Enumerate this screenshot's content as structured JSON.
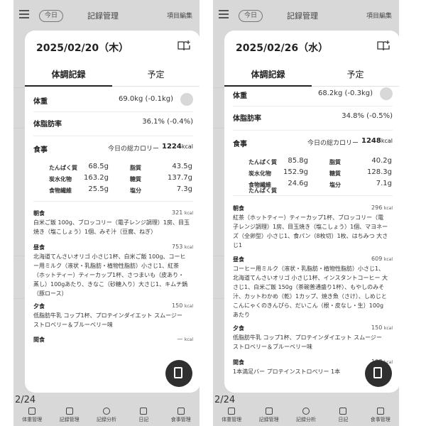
{
  "app": {
    "today_label": "今日",
    "title": "記録管理",
    "edit_label": "項目編集",
    "bg_date": "2/24",
    "nav": [
      "体重管理",
      "体重管理",
      "記録管理",
      "記録分析",
      "日記",
      "食事管理"
    ]
  },
  "left": {
    "date": "2025/02/20（木）",
    "tabs": [
      "体調記録",
      "予定"
    ],
    "weight_label": "体重",
    "weight_value": "69.0kg (-0.1kg)",
    "bodyfat_label": "体脂肪率",
    "bodyfat_value": "36.1% (-0.4%)",
    "meal_label": "食事",
    "total_label": "今日の総カロリー",
    "total_value": "1224",
    "kcal": "kcal",
    "nutrients": [
      {
        "name": "たんぱく質",
        "value": "68.5g"
      },
      {
        "name": "脂質",
        "value": "43.5g"
      },
      {
        "name": "炭水化物",
        "value": "163.2g"
      },
      {
        "name": "糖質",
        "value": "137.7g"
      },
      {
        "name": "食物繊維",
        "value": "25.5g"
      },
      {
        "name": "塩分",
        "value": "7.3g"
      }
    ],
    "meals": [
      {
        "name": "朝食",
        "kcal": "321",
        "text": "白米ご飯 100g、ブロッコリー（電子レンジ調理）1房、目玉焼き（塩こしょう）1個、みそ汁（豆腐、ねぎ）"
      },
      {
        "name": "昼食",
        "kcal": "753",
        "text": "北海道てんさいオリゴ 小さじ1杯、白米ご飯 100g、コーヒー用ミルク（液状・乳脂肪・植物性脂肪）小さじ1、紅茶（ホットティー）ティーカップ1杯、さつまいも（皮あり・蒸し）100gあたり、きなこ（砂糖入り）大さじ1、キムチ鍋（豚ロース）"
      },
      {
        "name": "夕食",
        "kcal": "150",
        "text": "低脂肪牛乳 コップ1杯、プロテインダイエット スムージー ストロベリー＆ブルーベリー味"
      },
      {
        "name": "間食",
        "kcal": "—",
        "text": ""
      }
    ]
  },
  "right": {
    "date": "2025/02/26（水）",
    "tabs": [
      "体調記録",
      "予定"
    ],
    "weight_label": "体重",
    "weight_value": "68.2kg (-0.3kg)",
    "bodyfat_label": "体脂肪率",
    "bodyfat_value": "34.8% (-0.5%)",
    "meal_label": "食事",
    "total_label": "今日の総カロリー",
    "total_value": "1248",
    "kcal": "kcal",
    "nutrients": [
      {
        "name": "たんぱく質",
        "value": "85.8g"
      },
      {
        "name": "脂質",
        "value": "40.2g"
      },
      {
        "name": "炭水化物",
        "value": "152.9g"
      },
      {
        "name": "糖質",
        "value": "128.3g"
      },
      {
        "name": "食物繊維",
        "value": "24.6g"
      },
      {
        "name": "塩分",
        "value": "7.1g"
      }
    ],
    "meals": [
      {
        "name": "朝食",
        "kcal": "296",
        "text": "紅茶（ホットティー）ティーカップ1杯、ブロッコリー（電子レンジ調理）1房、目玉焼き（塩こしょう）1個、マヨネーズ（全卵型）小さじ1、食パン（8枚切）1枚、はちみつ 大さじ1"
      },
      {
        "name": "昼食",
        "kcal": "609",
        "text": "コーヒー用ミルク（液状・乳脂肪・植物性脂肪）小さじ1、北海道てんさいオリゴ 小さじ1杯、インスタントコーヒー 大さじ1、白米ご飯 150g（茶碗普通盛り1杯）、もやしのみそ汁、カットわかめ（乾）1カップ、焼き魚（さけ）、しめじとこんにゃくのきんぴら、だいこん（根・皮なし・生）100gあたり"
      },
      {
        "name": "夕食",
        "kcal": "150",
        "text": "低脂肪牛乳 コップ1杯、プロテインダイエット スムージー ストロベリー＆ブルーベリー味"
      },
      {
        "name": "間食",
        "kcal": "107",
        "text": "1本満足バー プロテインストロベリー 1本"
      }
    ]
  }
}
